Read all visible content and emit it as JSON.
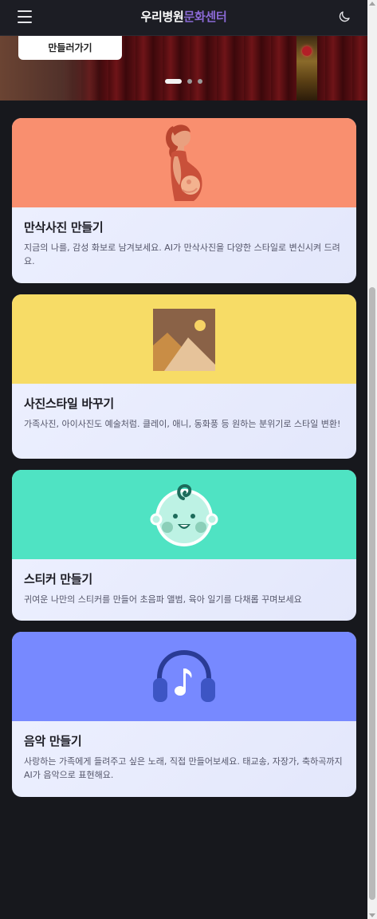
{
  "header": {
    "title_main": "우리병원",
    "title_accent": "문화센터",
    "accent_color": "#8b6ad6",
    "menu_icon": "hamburger-menu-icon",
    "theme_icon": "moon-icon"
  },
  "hero": {
    "button_label": "만들러가기",
    "slides_total": 3,
    "active_slide": 1
  },
  "cards": [
    {
      "title": "만삭사진 만들기",
      "description": "지금의 나를, 감성 화보로 남겨보세요. AI가 만삭사진을 다양한 스타일로 변신시켜 드려요.",
      "color": "#f98f6f",
      "icon": "pregnant-woman-icon"
    },
    {
      "title": "사진스타일 바꾸기",
      "description": "가족사진, 아이사진도 예술처럼. 클레이, 애니, 동화풍 등 원하는 분위기로 스타일 변환!",
      "color": "#f7dc66",
      "icon": "landscape-picture-icon"
    },
    {
      "title": "스티커 만들기",
      "description": "귀여운 나만의 스티커를 만들어 초음파 앨범, 육아 일기를 다채롭 꾸며보세요",
      "color": "#4fe3c3",
      "icon": "baby-face-icon"
    },
    {
      "title": "음악 만들기",
      "description": "사랑하는 가족에게 들려주고 싶은 노래, 직접 만들어보세요. 태교송, 자장가, 축하곡까지 AI가 음악으로 표현해요.",
      "color": "#7789ff",
      "icon": "headphones-music-icon"
    }
  ]
}
